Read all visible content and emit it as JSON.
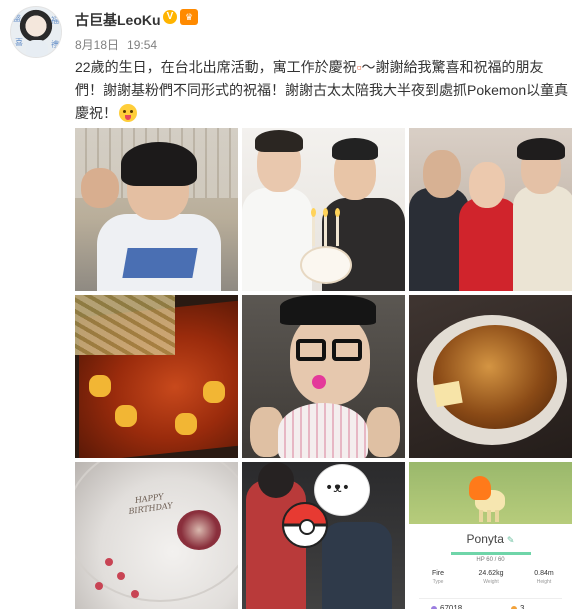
{
  "post": {
    "author": "古巨基LeoKu",
    "verified_badge": "V",
    "level_badge": "♛",
    "date": "8月18日",
    "time": "19:54",
    "text_line1_a": "22歲的生日，在台北出席活動，寓工作於慶祝",
    "text_line1_b": "～謝謝給我驚喜和祝福的朋友",
    "text_line2": "們！謝謝基粉們不同形式的祝福！謝謝古太太陪我大半夜到處抓Pokemon以童真",
    "text_line3": "慶祝！",
    "emoji": "tongue-out-emoji",
    "link_glyph": "▫"
  },
  "photos": {
    "dessert_plate_text": "HAPPY BIRTHDAY",
    "pokemon_card": {
      "name": "Ponyta",
      "hp_text": "HP 60 / 60",
      "hp_fraction": 1.0,
      "type_value": "Fire",
      "type_label": "Type",
      "weight_value": "24.62",
      "weight_unit": "kg",
      "weight_label": "Weight",
      "height_value": "0.84",
      "height_unit": "m",
      "height_label": "Height",
      "stardust": "67018",
      "candy": "3"
    }
  },
  "colors": {
    "link": "#eb7350",
    "name": "#333333",
    "meta": "#808080",
    "vip": "#ffb400"
  }
}
